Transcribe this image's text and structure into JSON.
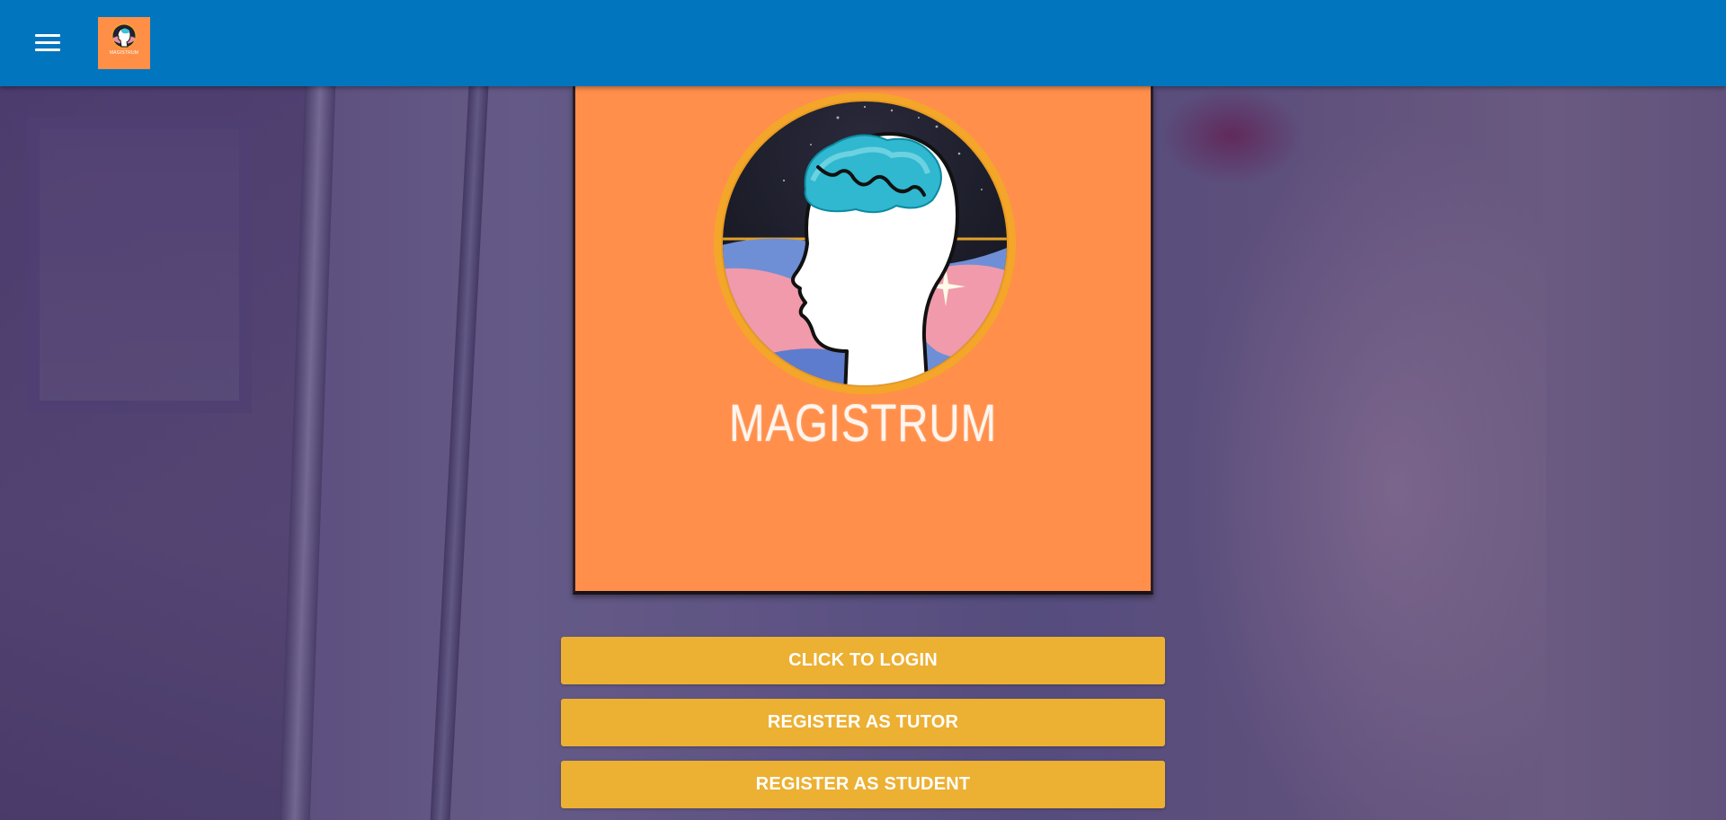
{
  "app": {
    "brand_name": "MAGISTRUM",
    "small_logo_caption": "MAGISTRUM"
  },
  "header": {
    "menu_icon": "hamburger-menu-icon",
    "logo_icon": "magistrum-logo-icon"
  },
  "actions": {
    "login_label": "CLICK TO LOGIN",
    "register_tutor_label": "REGISTER AS TUTOR",
    "register_student_label": "REGISTER AS STUDENT"
  },
  "colors": {
    "appbar": "#0275bf",
    "logo_background": "#ff8f4b",
    "button": "#ecb033",
    "button_text": "#ffffff"
  }
}
